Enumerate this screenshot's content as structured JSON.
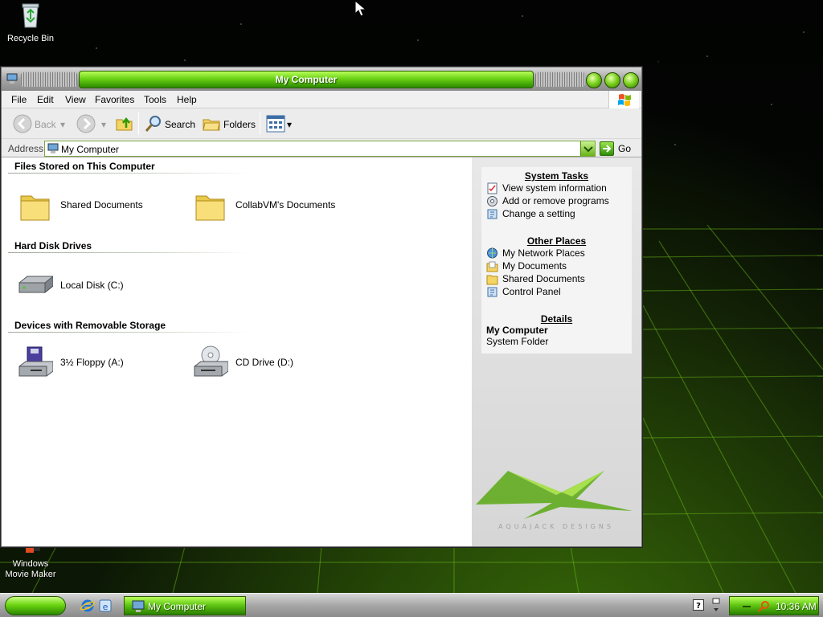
{
  "desktop": {
    "icons": [
      {
        "label": "Recycle Bin"
      },
      {
        "label": "Windows Movie Maker"
      }
    ]
  },
  "window": {
    "title": "My Computer",
    "menu": [
      "File",
      "Edit",
      "View",
      "Favorites",
      "Tools",
      "Help"
    ],
    "toolbar": {
      "back_label": "Back",
      "search_label": "Search",
      "folders_label": "Folders"
    },
    "address": {
      "label": "Address",
      "value": "My Computer",
      "go_label": "Go"
    },
    "groups": [
      {
        "header": "Files Stored on This Computer",
        "items": [
          {
            "label": "Shared Documents",
            "icon": "folder-icon"
          },
          {
            "label": "CollabVM's Documents",
            "icon": "folder-icon"
          }
        ]
      },
      {
        "header": "Hard Disk Drives",
        "items": [
          {
            "label": "Local Disk (C:)",
            "icon": "hard-disk-icon"
          }
        ]
      },
      {
        "header": "Devices with Removable Storage",
        "items": [
          {
            "label": "3½ Floppy (A:)",
            "icon": "floppy-drive-icon"
          },
          {
            "label": "CD Drive (D:)",
            "icon": "cd-drive-icon"
          }
        ]
      }
    ],
    "taskpane": {
      "system_tasks": {
        "title": "System Tasks",
        "links": [
          "View system information",
          "Add or remove programs",
          "Change a setting"
        ]
      },
      "other_places": {
        "title": "Other Places",
        "links": [
          "My Network Places",
          "My Documents",
          "Shared Documents",
          "Control Panel"
        ]
      },
      "details": {
        "title": "Details",
        "name": "My Computer",
        "type": "System Folder"
      },
      "brand_text": "AQUAJACK DESIGNS"
    }
  },
  "taskbar": {
    "task_label": "My Computer",
    "clock": "10:36 AM"
  },
  "colors": {
    "accent_green": "#6bd115",
    "dark_green": "#2c8a00"
  }
}
